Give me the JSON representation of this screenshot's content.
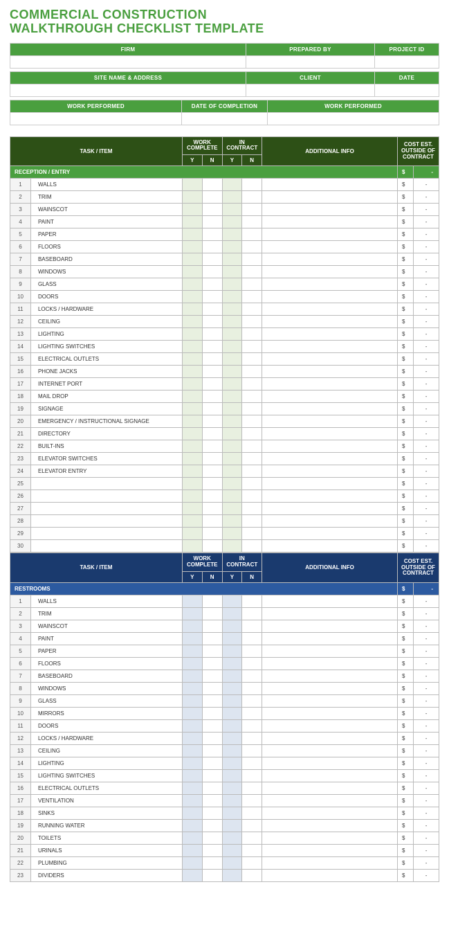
{
  "title_line1": "COMMERCIAL CONSTRUCTION",
  "title_line2": "WALKTHROUGH CHECKLIST TEMPLATE",
  "meta": {
    "firm": "FIRM",
    "prepared_by": "PREPARED BY",
    "project_id": "PROJECT ID",
    "site": "SITE NAME & ADDRESS",
    "client": "CLIENT",
    "date": "DATE",
    "work_performed": "WORK PERFORMED",
    "date_completion": "DATE OF COMPLETION",
    "work_performed2": "WORK PERFORMED"
  },
  "hdr": {
    "task": "TASK / ITEM",
    "work_complete": "WORK COMPLETE",
    "in_contract": "IN CONTRACT",
    "additional": "ADDITIONAL INFO",
    "cost_l1": "COST EST.",
    "cost_l2": "OUTSIDE OF",
    "cost_l3": "CONTRACT",
    "y": "Y",
    "n": "N"
  },
  "dollar": "$",
  "dash": "-",
  "sections": [
    {
      "theme": "green",
      "category": "RECEPTION / ENTRY",
      "rows": 30,
      "items": [
        "WALLS",
        "TRIM",
        "WAINSCOT",
        "PAINT",
        "PAPER",
        "FLOORS",
        "BASEBOARD",
        "WINDOWS",
        "GLASS",
        "DOORS",
        "LOCKS / HARDWARE",
        "CEILING",
        "LIGHTING",
        "LIGHTING SWITCHES",
        "ELECTRICAL OUTLETS",
        "PHONE JACKS",
        "INTERNET PORT",
        "MAIL DROP",
        "SIGNAGE",
        "EMERGENCY / INSTRUCTIONAL SIGNAGE",
        "DIRECTORY",
        "BUILT-INS",
        "ELEVATOR SWITCHES",
        "ELEVATOR ENTRY",
        "",
        "",
        "",
        "",
        "",
        ""
      ]
    },
    {
      "theme": "blue",
      "category": "RESTROOMS",
      "rows": 23,
      "items": [
        "WALLS",
        "TRIM",
        "WAINSCOT",
        "PAINT",
        "PAPER",
        "FLOORS",
        "BASEBOARD",
        "WINDOWS",
        "GLASS",
        "MIRRORS",
        "DOORS",
        "LOCKS / HARDWARE",
        "CEILING",
        "LIGHTING",
        "LIGHTING SWITCHES",
        "ELECTRICAL OUTLETS",
        "VENTILATION",
        "SINKS",
        "RUNNING WATER",
        "TOILETS",
        "URINALS",
        "PLUMBING",
        "DIVIDERS"
      ]
    }
  ]
}
